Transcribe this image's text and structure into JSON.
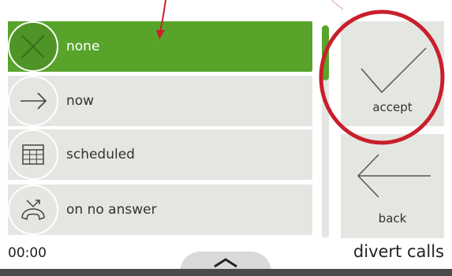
{
  "list": {
    "items": [
      {
        "label": "none",
        "icon": "cross-icon",
        "selected": true
      },
      {
        "label": "now",
        "icon": "arrow-right-icon",
        "selected": false
      },
      {
        "label": "scheduled",
        "icon": "calendar-icon",
        "selected": false
      },
      {
        "label": "on no answer",
        "icon": "missed-call-icon",
        "selected": false
      }
    ]
  },
  "buttons": {
    "accept_label": "accept",
    "back_label": "back"
  },
  "status": {
    "time": "00:00",
    "title": "divert calls"
  },
  "colors": {
    "accent_green": "#58a42a",
    "item_bg": "#e4e6e2",
    "annotation_red": "#c8202b"
  }
}
